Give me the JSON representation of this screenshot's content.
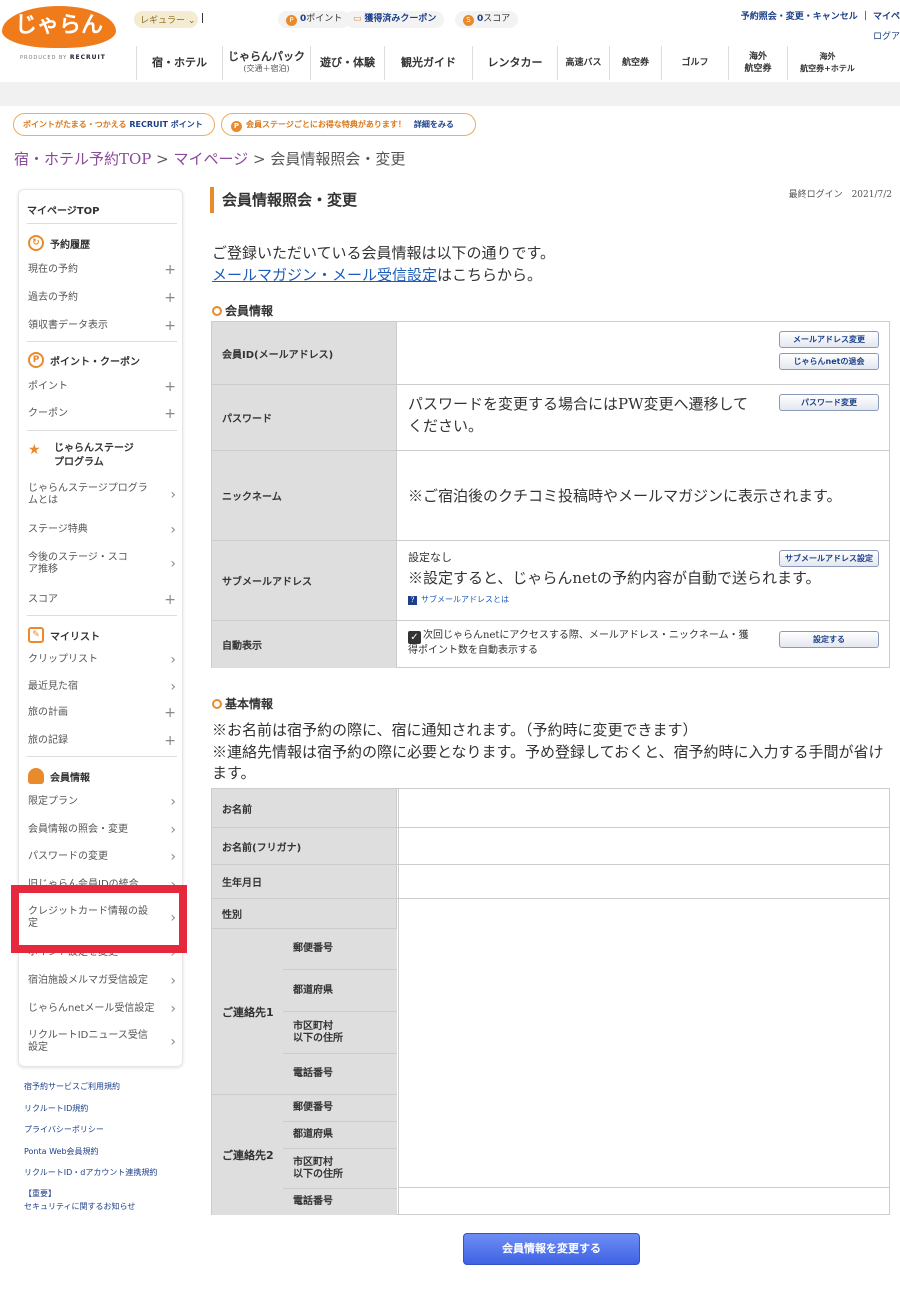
{
  "header": {
    "logo_text": "じゃらん",
    "logo_sub_prefix": "PRODUCED BY",
    "logo_sub_brand": "RECRUIT",
    "rank": "レギュラー",
    "points_num": "0",
    "points_label": "ポイント",
    "coupons": "獲得済みクーポン",
    "score_num": "0",
    "score_label": "スコア",
    "top_links": "予約照会・変更・キャンセル ｜ マイペ",
    "logout": "ログア"
  },
  "gnav": [
    {
      "label": "宿・ホテル",
      "sub": ""
    },
    {
      "label": "じゃらんパック",
      "sub": "(交通＋宿泊)"
    },
    {
      "label": "遊び・体験",
      "sub": ""
    },
    {
      "label": "観光ガイド",
      "sub": ""
    },
    {
      "label": "レンタカー",
      "sub": ""
    },
    {
      "label": "高速バス",
      "sub": ""
    },
    {
      "label": "航空券",
      "sub": ""
    },
    {
      "label": "ゴルフ",
      "sub": ""
    },
    {
      "label": "海外",
      "sub": "航空券"
    },
    {
      "label": "海外",
      "sub": "航空券+ホテル"
    }
  ],
  "banners": {
    "recruit_prefix": "ポイントがたまる・つかえる",
    "recruit_brand": "RECRUIT ポイント",
    "stage_text": "会員ステージごとにお得な特典があります！",
    "stage_more": "詳細をみる"
  },
  "breadcrumb": {
    "top": "宿・ホテル予約TOP",
    "sep1": " > ",
    "mypage": "マイページ",
    "sep2": " > ",
    "current": "会員情報照会・変更"
  },
  "sidebar": {
    "top": "マイページTOP",
    "sec_reserve": "予約履歴",
    "reserve_items": [
      "現在の予約",
      "過去の予約",
      "領収書データ表示"
    ],
    "sec_point": "ポイント・クーポン",
    "point_items": [
      "ポイント",
      "クーポン"
    ],
    "sec_stage_1": "じゃらんステージ",
    "sec_stage_2": "プログラム",
    "stage_items": [
      "じゃらんステージプログラムとは",
      "ステージ特典",
      "今後のステージ・スコア推移",
      "スコア"
    ],
    "sec_mylist": "マイリスト",
    "mylist_items": [
      "クリップリスト",
      "最近見た宿",
      "旅の計画",
      "旅の記録"
    ],
    "sec_member": "会員情報",
    "member_items": [
      "限定プラン",
      "会員情報の照会・変更",
      "パスワードの変更",
      "旧じゃらん会員IDの統合",
      "クレジットカード情報の設定",
      "ポイント設定を変更",
      "宿泊施設メルマガ受信設定",
      "じゃらんnetメール受信設定",
      "リクルートIDニュース受信設定"
    ]
  },
  "footer_links": [
    "宿予約サービスご利用規約",
    "リクルートID規約",
    "プライバシーポリシー",
    "Ponta Web会員規約",
    "リクルートID・dアカウント連携規約",
    "【重要】",
    "セキュリティに関するお知らせ"
  ],
  "main": {
    "title": "会員情報照会・変更",
    "last_login": "最終ログイン　2021/7/2",
    "intro_line1": "ご登録いただいている会員情報は以下の通りです。",
    "intro_link": "メールマガジン・メール受信設定",
    "intro_line2_suffix": "はこちらから。",
    "sec_member": "会員情報",
    "member_rows": {
      "id_label": "会員ID(メールアドレス)",
      "id_btn_change": "メールアドレス変更",
      "id_btn_quit": "じゃらんnetの退会",
      "pw_label": "パスワード",
      "pw_text": "パスワードを変更する場合にはPW変更へ遷移してください。",
      "pw_btn": "パスワード変更",
      "nick_label": "ニックネーム",
      "nick_text": "※ご宿泊後のクチコミ投稿時やメールマガジンに表示されます。",
      "sub_label": "サブメールアドレス",
      "sub_status": "設定なし",
      "sub_text": "※設定すると、じゃらんnetの予約内容が自動で送られます。",
      "sub_help": "サブメールアドレスとは",
      "sub_btn": "サブメールアドレス設定",
      "auto_label": "自動表示",
      "auto_text": "次回じゃらんnetにアクセスする際、メールアドレス・ニックネーム・獲得ポイント数を自動表示する",
      "auto_btn": "設定する"
    },
    "sec_basic": "基本情報",
    "basic_note1": "※お名前は宿予約の際に、宿に通知されます。（予約時に変更できます）",
    "basic_note2": "※連絡先情報は宿予約の際に必要となります。予め登録しておくと、宿予約時に入力する手間が省けます。",
    "basic_rows": {
      "name": "お名前",
      "kana": "お名前(フリガナ)",
      "birth": "生年月日",
      "sex": "性別",
      "contact1": "ご連絡先1",
      "contact2": "ご連絡先2",
      "zip": "郵便番号",
      "pref": "都道府県",
      "city_1": "市区町村",
      "city_2": "以下の住所",
      "tel": "電話番号"
    },
    "submit": "会員情報を変更する"
  }
}
